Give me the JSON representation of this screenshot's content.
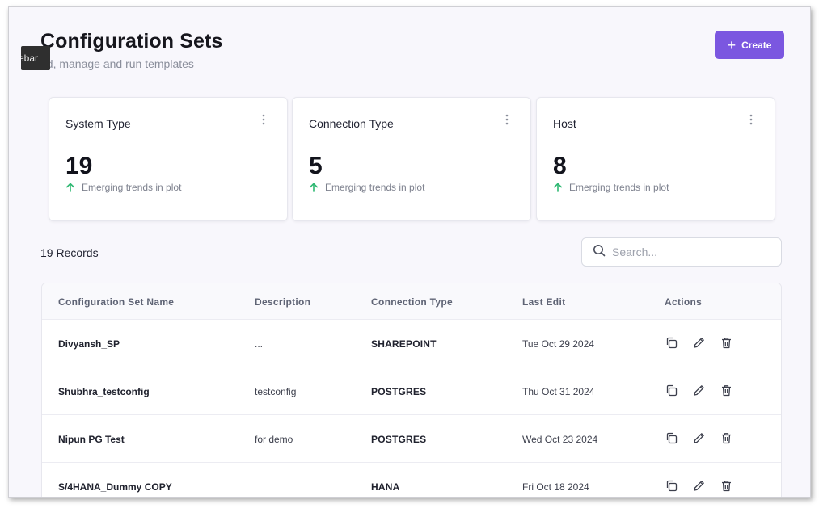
{
  "header": {
    "title": "Configuration Sets",
    "subtitle": "dd, manage and run templates",
    "tooltip": "ebar",
    "create_label": "Create"
  },
  "stats": [
    {
      "label": "System Type",
      "value": "19",
      "trend": "Emerging trends in plot"
    },
    {
      "label": "Connection Type",
      "value": "5",
      "trend": "Emerging trends in plot"
    },
    {
      "label": "Host",
      "value": "8",
      "trend": "Emerging trends in plot"
    }
  ],
  "records": {
    "count_label": "19 Records"
  },
  "search": {
    "placeholder": "Search..."
  },
  "table": {
    "columns": [
      "Configuration Set Name",
      "Description",
      "Connection Type",
      "Last Edit",
      "Actions"
    ],
    "rows": [
      {
        "name": "Divyansh_SP",
        "description": "...",
        "connection": "SHAREPOINT",
        "last_edit": "Tue Oct 29 2024"
      },
      {
        "name": "Shubhra_testconfig",
        "description": "testconfig",
        "connection": "POSTGRES",
        "last_edit": "Thu Oct 31 2024"
      },
      {
        "name": "Nipun PG Test",
        "description": "for demo",
        "connection": "POSTGRES",
        "last_edit": "Wed Oct 23 2024"
      },
      {
        "name": "S/4HANA_Dummy COPY",
        "description": "",
        "connection": "HANA",
        "last_edit": "Fri Oct 18 2024"
      }
    ]
  },
  "colors": {
    "accent": "#7b57e0",
    "trend_up": "#2eb872",
    "background": "#f8f7fc"
  },
  "icons": [
    "plus-icon",
    "kebab-icon",
    "arrow-up-icon",
    "search-icon",
    "copy-icon",
    "edit-icon",
    "trash-icon"
  ]
}
